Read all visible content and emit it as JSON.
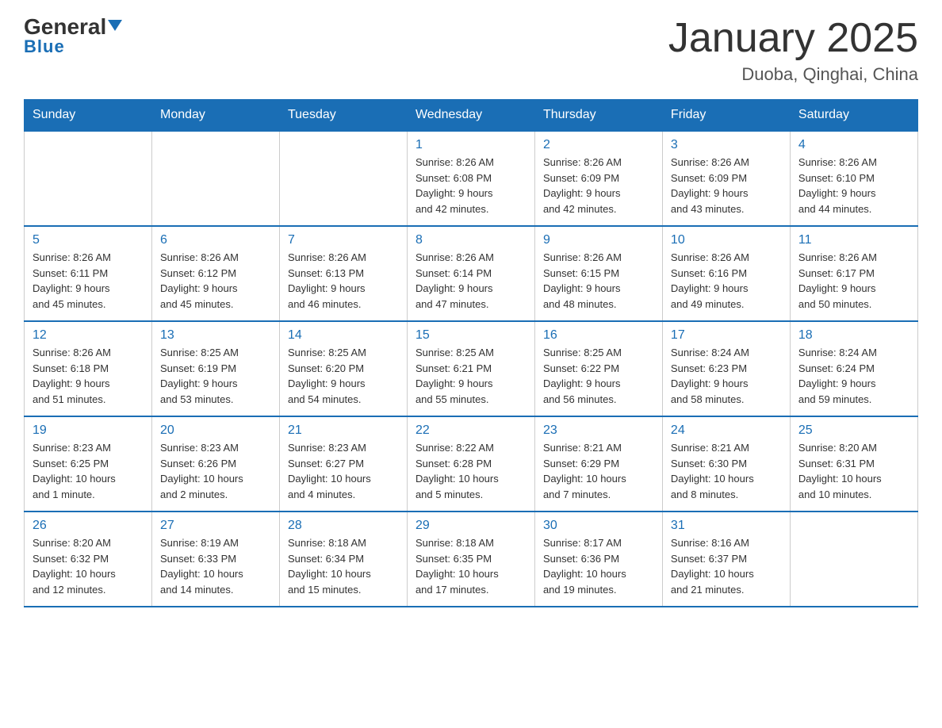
{
  "logo": {
    "general": "General",
    "blue": "Blue"
  },
  "title": "January 2025",
  "subtitle": "Duoba, Qinghai, China",
  "days_of_week": [
    "Sunday",
    "Monday",
    "Tuesday",
    "Wednesday",
    "Thursday",
    "Friday",
    "Saturday"
  ],
  "weeks": [
    [
      {
        "day": "",
        "info": ""
      },
      {
        "day": "",
        "info": ""
      },
      {
        "day": "",
        "info": ""
      },
      {
        "day": "1",
        "info": "Sunrise: 8:26 AM\nSunset: 6:08 PM\nDaylight: 9 hours\nand 42 minutes."
      },
      {
        "day": "2",
        "info": "Sunrise: 8:26 AM\nSunset: 6:09 PM\nDaylight: 9 hours\nand 42 minutes."
      },
      {
        "day": "3",
        "info": "Sunrise: 8:26 AM\nSunset: 6:09 PM\nDaylight: 9 hours\nand 43 minutes."
      },
      {
        "day": "4",
        "info": "Sunrise: 8:26 AM\nSunset: 6:10 PM\nDaylight: 9 hours\nand 44 minutes."
      }
    ],
    [
      {
        "day": "5",
        "info": "Sunrise: 8:26 AM\nSunset: 6:11 PM\nDaylight: 9 hours\nand 45 minutes."
      },
      {
        "day": "6",
        "info": "Sunrise: 8:26 AM\nSunset: 6:12 PM\nDaylight: 9 hours\nand 45 minutes."
      },
      {
        "day": "7",
        "info": "Sunrise: 8:26 AM\nSunset: 6:13 PM\nDaylight: 9 hours\nand 46 minutes."
      },
      {
        "day": "8",
        "info": "Sunrise: 8:26 AM\nSunset: 6:14 PM\nDaylight: 9 hours\nand 47 minutes."
      },
      {
        "day": "9",
        "info": "Sunrise: 8:26 AM\nSunset: 6:15 PM\nDaylight: 9 hours\nand 48 minutes."
      },
      {
        "day": "10",
        "info": "Sunrise: 8:26 AM\nSunset: 6:16 PM\nDaylight: 9 hours\nand 49 minutes."
      },
      {
        "day": "11",
        "info": "Sunrise: 8:26 AM\nSunset: 6:17 PM\nDaylight: 9 hours\nand 50 minutes."
      }
    ],
    [
      {
        "day": "12",
        "info": "Sunrise: 8:26 AM\nSunset: 6:18 PM\nDaylight: 9 hours\nand 51 minutes."
      },
      {
        "day": "13",
        "info": "Sunrise: 8:25 AM\nSunset: 6:19 PM\nDaylight: 9 hours\nand 53 minutes."
      },
      {
        "day": "14",
        "info": "Sunrise: 8:25 AM\nSunset: 6:20 PM\nDaylight: 9 hours\nand 54 minutes."
      },
      {
        "day": "15",
        "info": "Sunrise: 8:25 AM\nSunset: 6:21 PM\nDaylight: 9 hours\nand 55 minutes."
      },
      {
        "day": "16",
        "info": "Sunrise: 8:25 AM\nSunset: 6:22 PM\nDaylight: 9 hours\nand 56 minutes."
      },
      {
        "day": "17",
        "info": "Sunrise: 8:24 AM\nSunset: 6:23 PM\nDaylight: 9 hours\nand 58 minutes."
      },
      {
        "day": "18",
        "info": "Sunrise: 8:24 AM\nSunset: 6:24 PM\nDaylight: 9 hours\nand 59 minutes."
      }
    ],
    [
      {
        "day": "19",
        "info": "Sunrise: 8:23 AM\nSunset: 6:25 PM\nDaylight: 10 hours\nand 1 minute."
      },
      {
        "day": "20",
        "info": "Sunrise: 8:23 AM\nSunset: 6:26 PM\nDaylight: 10 hours\nand 2 minutes."
      },
      {
        "day": "21",
        "info": "Sunrise: 8:23 AM\nSunset: 6:27 PM\nDaylight: 10 hours\nand 4 minutes."
      },
      {
        "day": "22",
        "info": "Sunrise: 8:22 AM\nSunset: 6:28 PM\nDaylight: 10 hours\nand 5 minutes."
      },
      {
        "day": "23",
        "info": "Sunrise: 8:21 AM\nSunset: 6:29 PM\nDaylight: 10 hours\nand 7 minutes."
      },
      {
        "day": "24",
        "info": "Sunrise: 8:21 AM\nSunset: 6:30 PM\nDaylight: 10 hours\nand 8 minutes."
      },
      {
        "day": "25",
        "info": "Sunrise: 8:20 AM\nSunset: 6:31 PM\nDaylight: 10 hours\nand 10 minutes."
      }
    ],
    [
      {
        "day": "26",
        "info": "Sunrise: 8:20 AM\nSunset: 6:32 PM\nDaylight: 10 hours\nand 12 minutes."
      },
      {
        "day": "27",
        "info": "Sunrise: 8:19 AM\nSunset: 6:33 PM\nDaylight: 10 hours\nand 14 minutes."
      },
      {
        "day": "28",
        "info": "Sunrise: 8:18 AM\nSunset: 6:34 PM\nDaylight: 10 hours\nand 15 minutes."
      },
      {
        "day": "29",
        "info": "Sunrise: 8:18 AM\nSunset: 6:35 PM\nDaylight: 10 hours\nand 17 minutes."
      },
      {
        "day": "30",
        "info": "Sunrise: 8:17 AM\nSunset: 6:36 PM\nDaylight: 10 hours\nand 19 minutes."
      },
      {
        "day": "31",
        "info": "Sunrise: 8:16 AM\nSunset: 6:37 PM\nDaylight: 10 hours\nand 21 minutes."
      },
      {
        "day": "",
        "info": ""
      }
    ]
  ]
}
